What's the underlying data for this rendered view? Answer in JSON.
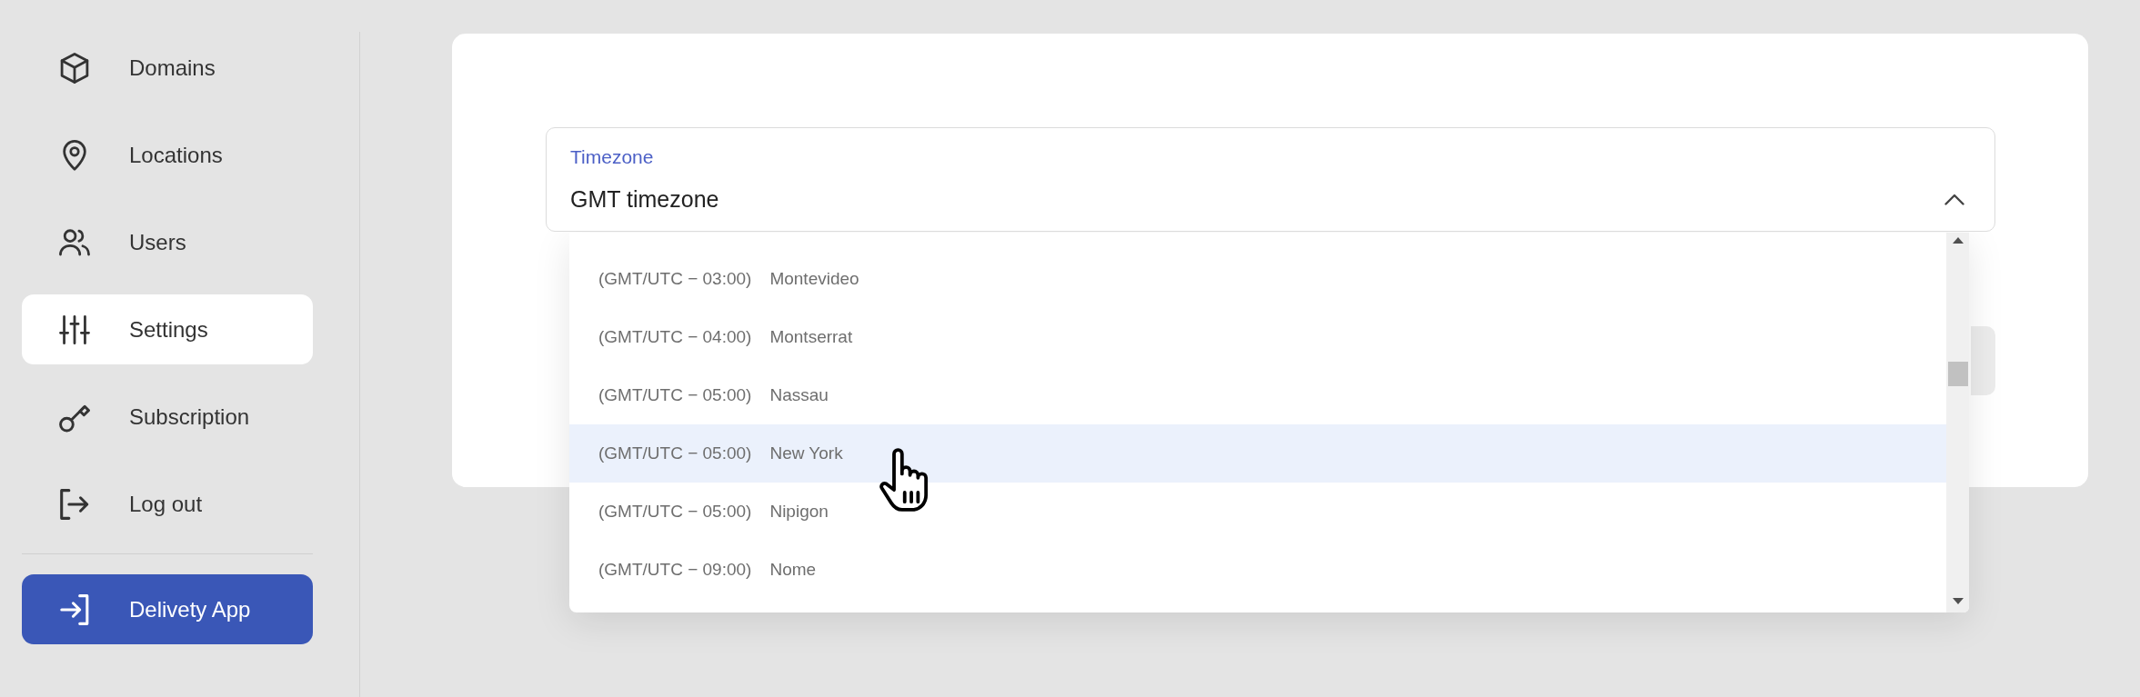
{
  "sidebar": {
    "items": [
      {
        "label": "Domains",
        "selected": false
      },
      {
        "label": "Locations",
        "selected": false
      },
      {
        "label": "Users",
        "selected": false
      },
      {
        "label": "Settings",
        "selected": true
      },
      {
        "label": "Subscription",
        "selected": false
      },
      {
        "label": "Log out",
        "selected": false
      }
    ],
    "app_button": {
      "label": "Delivety App"
    }
  },
  "timezone_field": {
    "label": "Timezone",
    "value": "GMT timezone",
    "expanded": true
  },
  "timezone_options": [
    {
      "offset": "(GMT/UTC − 03:00)",
      "city": "Montevideo",
      "highlighted": false
    },
    {
      "offset": "(GMT/UTC − 04:00)",
      "city": "Montserrat",
      "highlighted": false
    },
    {
      "offset": "(GMT/UTC − 05:00)",
      "city": "Nassau",
      "highlighted": false
    },
    {
      "offset": "(GMT/UTC − 05:00)",
      "city": "New York",
      "highlighted": true
    },
    {
      "offset": "(GMT/UTC − 05:00)",
      "city": "Nipigon",
      "highlighted": false
    },
    {
      "offset": "(GMT/UTC − 09:00)",
      "city": "Nome",
      "highlighted": false
    }
  ]
}
